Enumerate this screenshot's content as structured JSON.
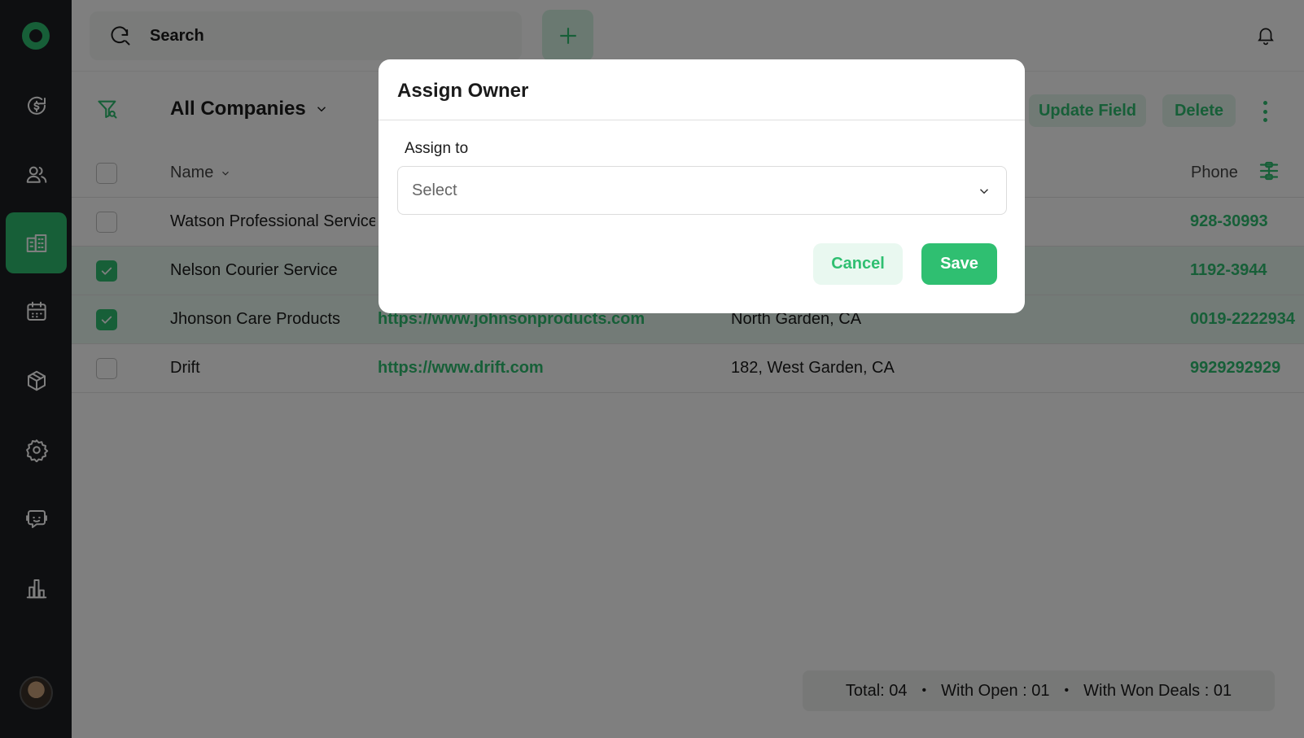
{
  "header": {
    "search_placeholder": "Search"
  },
  "toolbar": {
    "view_title": "All Companies",
    "update_field_label": "Update Field",
    "delete_label": "Delete"
  },
  "table": {
    "columns": {
      "name": "Name",
      "phone": "Phone"
    },
    "rows": [
      {
        "name": "Watson Professional Services",
        "website": "",
        "address": "",
        "phone": "928-30993",
        "checked": false
      },
      {
        "name": "Nelson Courier Service",
        "website": "",
        "address": "",
        "phone": "1192-3944",
        "checked": true
      },
      {
        "name": "Jhonson Care Products",
        "website": "https://www.johnsonproducts.com",
        "address": "North Garden, CA",
        "phone": "0019-2222934",
        "checked": true
      },
      {
        "name": "Drift",
        "website": "https://www.drift.com",
        "address": "182, West Garden, CA",
        "phone": "9929292929",
        "checked": false
      }
    ]
  },
  "totals": {
    "total": "Total: 04",
    "with_open": "With Open : 01",
    "with_won": "With Won Deals : 01",
    "separator": "•"
  },
  "modal": {
    "title": "Assign Owner",
    "field_label": "Assign to",
    "select_placeholder": "Select",
    "cancel_label": "Cancel",
    "save_label": "Save"
  },
  "colors": {
    "accent": "#2fbf71",
    "sidebar": "#1d1e22",
    "overlay": "rgba(0,0,0,0.5)"
  },
  "icons": {
    "sidebar": [
      "dollar-refresh-icon",
      "users-icon",
      "building-icon",
      "calendar-icon",
      "box-icon",
      "gear-icon",
      "chat-icon",
      "bar-chart-icon"
    ]
  }
}
